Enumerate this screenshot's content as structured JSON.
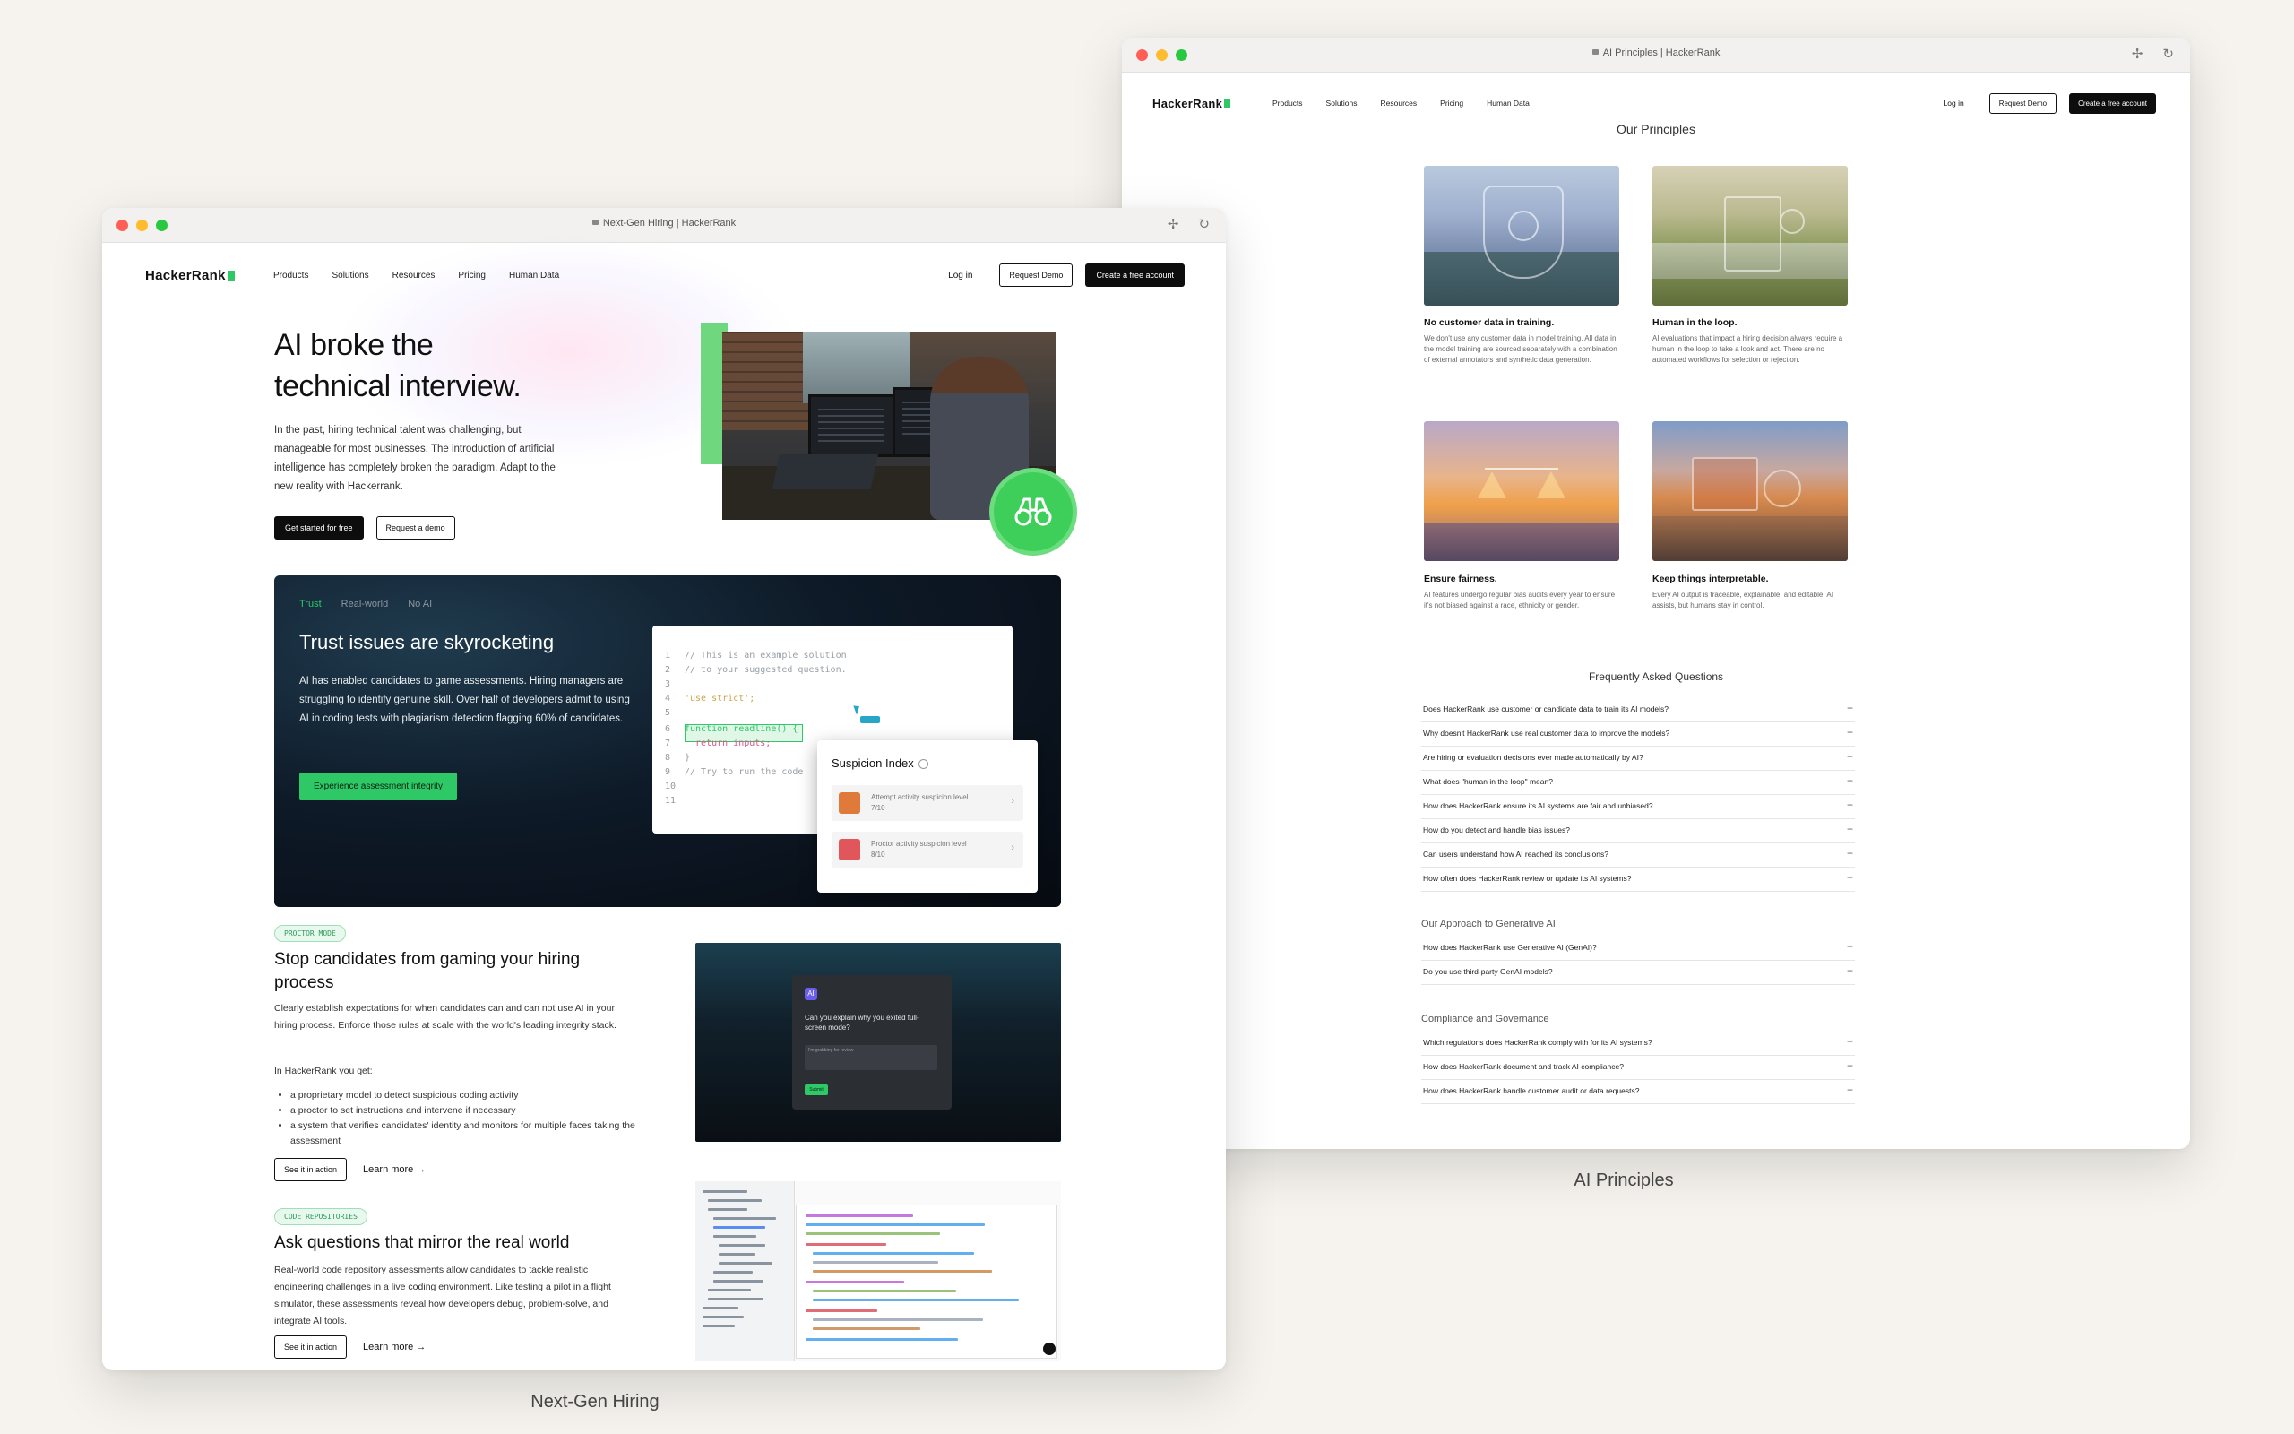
{
  "left_window": {
    "url": "Next-Gen Hiring | HackerRank",
    "nav": {
      "logo": "HackerRank",
      "links": [
        "Products",
        "Solutions",
        "Resources",
        "Pricing",
        "Human Data"
      ],
      "login": "Log in",
      "request_demo": "Request Demo",
      "create_account": "Create a free account"
    },
    "hero": {
      "title_line1": "AI broke the",
      "title_line2": "technical interview.",
      "description": "In the past, hiring technical talent was challenging, but manageable for most businesses. The introduction of artificial intelligence has completely broken the paradigm. Adapt to the new reality with Hackerrank.",
      "primary_cta": "Get started for free",
      "secondary_cta": "Request a demo"
    },
    "trust_panel": {
      "tabs": [
        "Trust",
        "Real-world",
        "No AI"
      ],
      "title": "Trust issues are skyrocketing",
      "description": "AI has enabled candidates to game assessments. Hiring managers are struggling to identify genuine skill. Over half of developers admit to using AI in coding tests with plagiarism detection flagging 60% of candidates.",
      "cta": "Experience assessment integrity",
      "code_lines": [
        {
          "n": "1",
          "text": "// This is an example solution"
        },
        {
          "n": "2",
          "text": "// to your suggested question."
        },
        {
          "n": "3",
          "text": ""
        },
        {
          "n": "4",
          "text": "'use strict';"
        },
        {
          "n": "5",
          "text": ""
        },
        {
          "n": "6",
          "text": "function readline() {"
        },
        {
          "n": "7",
          "text": "  return inputs;"
        },
        {
          "n": "8",
          "text": "}"
        },
        {
          "n": "9",
          "text": "// Try to run the code"
        },
        {
          "n": "10",
          "text": ""
        },
        {
          "n": "11",
          "text": ""
        }
      ],
      "suspicion": {
        "title": "Suspicion Index",
        "rows": [
          {
            "label": "Attempt activity suspicion level",
            "value": "7/10",
            "color": "#e07a3a"
          },
          {
            "label": "Proctor activity suspicion level",
            "value": "8/10",
            "color": "#e0565b"
          }
        ]
      }
    },
    "proctor_section": {
      "tag": "PROCTOR MODE",
      "title": "Stop candidates from gaming your hiring process",
      "description": "Clearly establish expectations for when candidates can and can not use AI in your hiring process. Enforce those rules at scale with the world's leading integrity stack.",
      "list_intro": "In HackerRank you get:",
      "list": [
        "a proprietary model to detect suspicious coding activity",
        "a proctor to set instructions and intervene if necessary",
        "a system that verifies candidates' identity and monitors for multiple faces taking the assessment"
      ],
      "see_action": "See it in action",
      "learn_more": "Learn more",
      "modal_question": "Can you explain why you exited full-screen mode?",
      "modal_placeholder": "I'm grabbing for review",
      "modal_submit": "Submit"
    },
    "code_repo_section": {
      "tag": "CODE REPOSITORIES",
      "title": "Ask questions that mirror the real world",
      "description": "Real-world code repository assessments allow candidates to tackle realistic engineering challenges in a live coding environment. Like testing a pilot in a flight simulator, these assessments reveal how developers debug, problem-solve, and integrate AI tools.",
      "see_action": "See it in action",
      "learn_more": "Learn more"
    }
  },
  "right_window": {
    "url": "AI Principles | HackerRank",
    "nav": {
      "logo": "HackerRank",
      "links": [
        "Products",
        "Solutions",
        "Resources",
        "Pricing",
        "Human Data"
      ],
      "login": "Log in",
      "request_demo": "Request Demo",
      "create_account": "Create a free account"
    },
    "principles_heading": "Our Principles",
    "principles": [
      {
        "title": "No customer data in training.",
        "desc": "We don't use any customer data in model training. All data in the model training are sourced separately with a combination of external annotators and synthetic data generation."
      },
      {
        "title": "Human in the loop.",
        "desc": "AI evaluations that impact a hiring decision always require a human in the loop to take a look and act. There are no automated workflows for selection or rejection."
      },
      {
        "title": "Ensure fairness.",
        "desc": "AI features undergo regular bias audits every year to ensure it's not biased against a race, ethnicity or gender."
      },
      {
        "title": "Keep things interpretable.",
        "desc": "Every AI output is traceable, explainable, and editable. AI assists, but humans stay in control."
      }
    ],
    "faq_heading": "Frequently Asked Questions",
    "faq_general": [
      "Does HackerRank use customer or candidate data to train its AI models?",
      "Why doesn't HackerRank use real customer data to improve the models?",
      "Are hiring or evaluation decisions ever made automatically by AI?",
      "What does \"human in the loop\" mean?",
      "How does HackerRank ensure its AI systems are fair and unbiased?",
      "How do you detect and handle bias issues?",
      "Can users understand how AI reached its conclusions?",
      "How often does HackerRank review or update its AI systems?"
    ],
    "genai_heading": "Our Approach to Generative AI",
    "faq_genai": [
      "How does HackerRank use Generative AI (GenAI)?",
      "Do you use third-party GenAI models?"
    ],
    "compliance_heading": "Compliance and Governance",
    "faq_compliance": [
      "Which regulations does HackerRank comply with for its AI systems?",
      "How does HackerRank document and track AI compliance?",
      "How does HackerRank handle customer audit or data requests?"
    ]
  },
  "captions": {
    "left": "Next-Gen Hiring",
    "right": "AI Principles"
  },
  "colors": {
    "brand_green": "#2ec866",
    "dark": "#0d0d0d",
    "background": "#f6f3ee"
  }
}
